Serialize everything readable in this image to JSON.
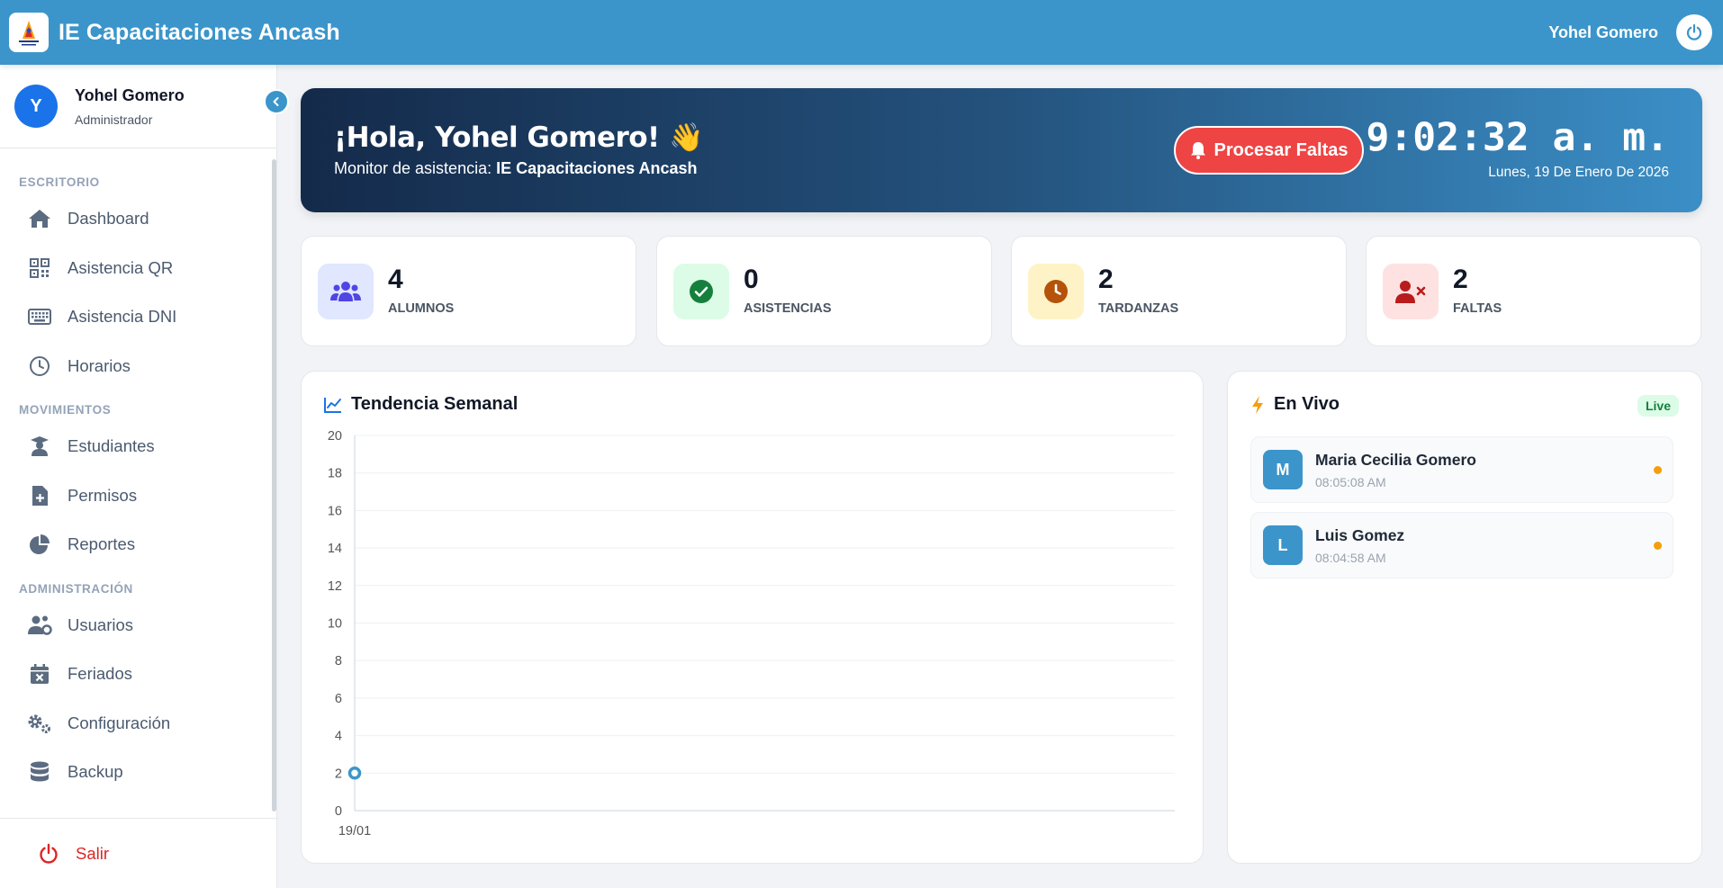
{
  "header": {
    "app_title": "IE Capacitaciones Ancash",
    "user_name": "Yohel Gomero",
    "logo_icon": "school-logo",
    "power_icon": "power-icon"
  },
  "sidebar": {
    "profile": {
      "initial": "Y",
      "name": "Yohel Gomero",
      "role": "Administrador"
    },
    "sections": [
      {
        "title": "ESCRITORIO",
        "items": [
          {
            "label": "Dashboard",
            "icon": "home-icon"
          },
          {
            "label": "Asistencia QR",
            "icon": "qr-code-icon"
          },
          {
            "label": "Asistencia DNI",
            "icon": "keyboard-icon"
          },
          {
            "label": "Horarios",
            "icon": "clock-icon"
          }
        ]
      },
      {
        "title": "MOVIMIENTOS",
        "items": [
          {
            "label": "Estudiantes",
            "icon": "graduate-icon"
          },
          {
            "label": "Permisos",
            "icon": "file-plus-icon"
          },
          {
            "label": "Reportes",
            "icon": "pie-chart-icon"
          }
        ]
      },
      {
        "title": "ADMINISTRACIÓN",
        "items": [
          {
            "label": "Usuarios",
            "icon": "users-cog-icon"
          },
          {
            "label": "Feriados",
            "icon": "calendar-x-icon"
          },
          {
            "label": "Configuración",
            "icon": "gears-icon"
          },
          {
            "label": "Backup",
            "icon": "database-icon"
          }
        ]
      }
    ],
    "logout_label": "Salir"
  },
  "hero": {
    "greeting": "¡Hola, Yohel Gomero! 👋",
    "subtitle_prefix": "Monitor de asistencia: ",
    "subtitle_school": "IE Capacitaciones Ancash",
    "button_label": "Procesar Faltas",
    "time": "9:02:32 a. m.",
    "date": "Lunes, 19 De Enero De 2026"
  },
  "stats": [
    {
      "value": "4",
      "label": "ALUMNOS",
      "icon": "users-icon",
      "bg": "#e0e7ff",
      "color": "#4f46e5"
    },
    {
      "value": "0",
      "label": "ASISTENCIAS",
      "icon": "check-circle-icon",
      "bg": "#dcfce7",
      "color": "#15803d"
    },
    {
      "value": "2",
      "label": "TARDANZAS",
      "icon": "clock-icon",
      "bg": "#fef3c7",
      "color": "#b45309"
    },
    {
      "value": "2",
      "label": "FALTAS",
      "icon": "user-times-icon",
      "bg": "#fee2e2",
      "color": "#b91c1c"
    }
  ],
  "chart_card": {
    "title": "Tendencia Semanal"
  },
  "chart_data": {
    "type": "line",
    "title": "Tendencia Semanal",
    "categories": [
      "19/01"
    ],
    "series": [
      {
        "values": [
          2
        ]
      }
    ],
    "ylim": [
      0,
      20
    ],
    "yticks": [
      0,
      2,
      4,
      6,
      8,
      10,
      12,
      14,
      16,
      18,
      20
    ],
    "xlabel": "",
    "ylabel": "",
    "grid": true,
    "line_color": "#3b95ca"
  },
  "live": {
    "title": "En Vivo",
    "badge": "Live",
    "items": [
      {
        "initial": "M",
        "name": "Maria Cecilia Gomero",
        "time": "08:05:08 AM"
      },
      {
        "initial": "L",
        "name": "Luis Gomez",
        "time": "08:04:58 AM"
      }
    ]
  }
}
